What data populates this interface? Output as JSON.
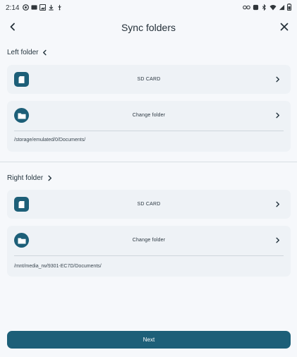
{
  "status_bar": {
    "time": "2:14",
    "left_icons": [
      "chrome-icon",
      "gallery-icon",
      "image-icon",
      "download-icon",
      "usb-icon"
    ],
    "right_icons": [
      "link-icon",
      "alarm-icon",
      "bluetooth-icon",
      "wifi-icon",
      "signal-icon",
      "battery-icon"
    ]
  },
  "header": {
    "title": "Sync folders"
  },
  "left_folder": {
    "label": "Left folder",
    "storage": {
      "label": "SD CARD",
      "icon": "sd-card-icon"
    },
    "folder": {
      "label": "Change folder",
      "icon": "folder-icon"
    },
    "path": "/storage/emulated/0/Documents/"
  },
  "right_folder": {
    "label": "Right folder",
    "storage": {
      "label": "SD CARD",
      "icon": "sd-card-icon"
    },
    "folder": {
      "label": "Change folder",
      "icon": "folder-icon"
    },
    "path": "/mnt/media_rw/9301-EC7D/Documents/"
  },
  "footer": {
    "next_label": "Next"
  },
  "colors": {
    "accent": "#1d5f78",
    "background": "#f6f8fb",
    "card": "#eef2f6"
  }
}
